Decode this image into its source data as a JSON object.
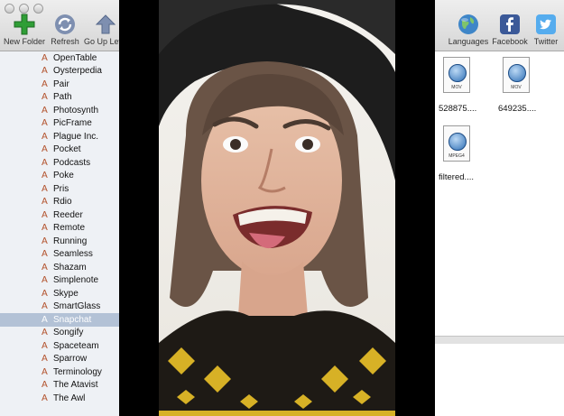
{
  "toolbar": {
    "new_folder": "New Folder",
    "refresh": "Refresh",
    "go_up": "Go Up Level",
    "languages": "Languages",
    "facebook": "Facebook",
    "twitter": "Twitter"
  },
  "sidebar": {
    "items": [
      {
        "label": "OpenTable"
      },
      {
        "label": "Oysterpedia"
      },
      {
        "label": "Pair"
      },
      {
        "label": "Path"
      },
      {
        "label": "Photosynth"
      },
      {
        "label": "PicFrame"
      },
      {
        "label": "Plague Inc."
      },
      {
        "label": "Pocket"
      },
      {
        "label": "Podcasts"
      },
      {
        "label": "Poke"
      },
      {
        "label": "Pris"
      },
      {
        "label": "Rdio"
      },
      {
        "label": "Reeder"
      },
      {
        "label": "Remote"
      },
      {
        "label": "Running"
      },
      {
        "label": "Seamless"
      },
      {
        "label": "Shazam"
      },
      {
        "label": "Simplenote"
      },
      {
        "label": "Skype"
      },
      {
        "label": "SmartGlass"
      },
      {
        "label": "Snapchat"
      },
      {
        "label": "Songify"
      },
      {
        "label": "Spaceteam"
      },
      {
        "label": "Sparrow"
      },
      {
        "label": "Terminology"
      },
      {
        "label": "The Atavist"
      },
      {
        "label": "The Awl"
      }
    ],
    "selected_item": "Snapchat"
  },
  "files": [
    {
      "name": "528875....",
      "ext": "MOV"
    },
    {
      "name": "649235....",
      "ext": "MOV"
    },
    {
      "name": "filtered....",
      "ext": "MPEG4"
    }
  ],
  "colors": {
    "selection": "#b3c2d6",
    "sidebar_bg": "#eef1f5",
    "app_icon": "#b2502a",
    "new_folder_plus": "#2f9e36",
    "facebook": "#3b5998",
    "twitter": "#55acee"
  },
  "icons": {
    "new_folder": "plus-icon",
    "refresh": "refresh-icon",
    "go_up": "up-arrow-icon",
    "languages": "globe-icon",
    "facebook": "facebook-icon",
    "twitter": "twitter-bird-icon",
    "app": "app-store-icon",
    "file": "quicktime-file-icon"
  }
}
